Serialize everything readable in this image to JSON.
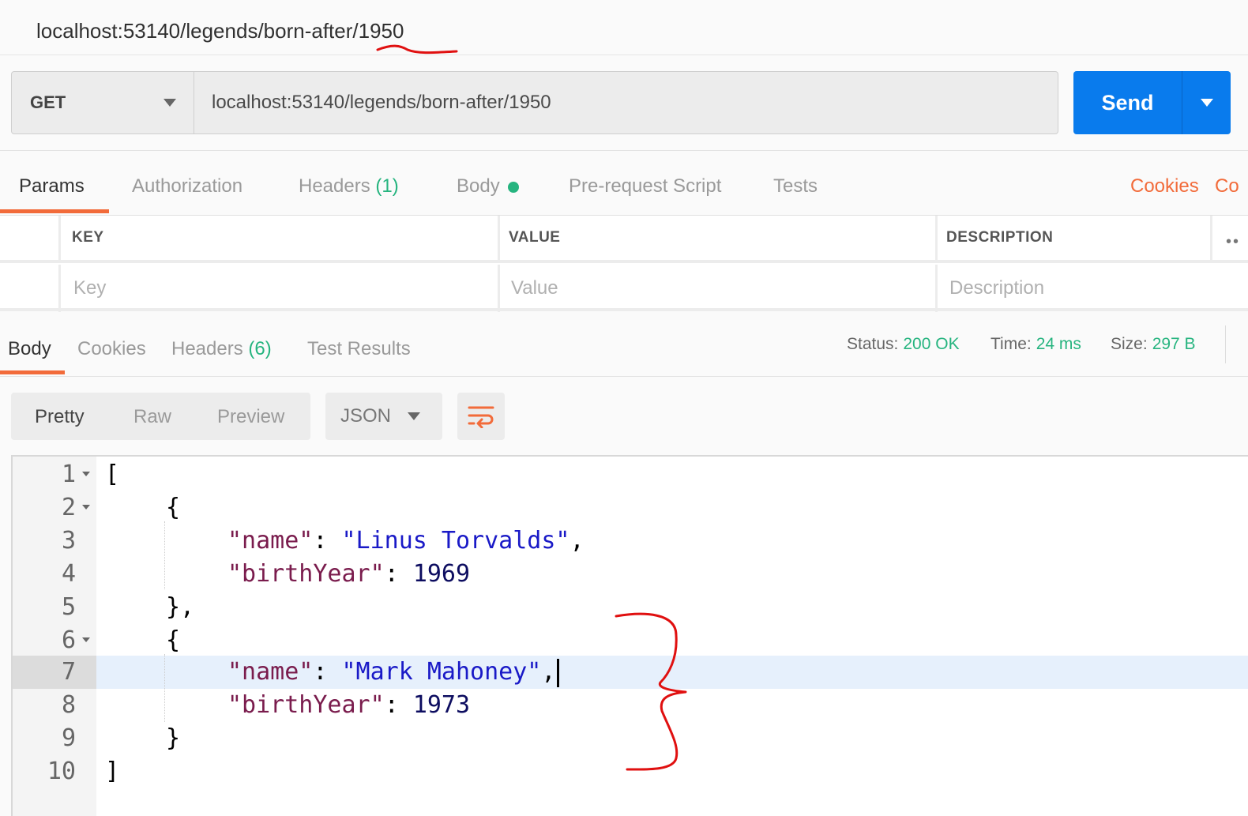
{
  "request": {
    "tab_title": "localhost:53140/legends/born-after/1950",
    "method": "GET",
    "url": "localhost:53140/legends/born-after/1950",
    "send_label": "Send"
  },
  "request_tabs": {
    "params": "Params",
    "authorization": "Authorization",
    "headers_label": "Headers",
    "headers_count": "(1)",
    "body": "Body",
    "prerequest": "Pre-request Script",
    "tests": "Tests",
    "cookies": "Cookies",
    "code_partial": "Co"
  },
  "params_table": {
    "col_key": "KEY",
    "col_value": "VALUE",
    "col_description": "DESCRIPTION",
    "key_placeholder": "Key",
    "value_placeholder": "Value",
    "description_placeholder": "Description"
  },
  "response_tabs": {
    "body": "Body",
    "cookies": "Cookies",
    "headers_label": "Headers",
    "headers_count": "(6)",
    "test_results": "Test Results"
  },
  "response_stats": {
    "status_label": "Status:",
    "status_value": "200 OK",
    "time_label": "Time:",
    "time_value": "24 ms",
    "size_label": "Size:",
    "size_value": "297 B"
  },
  "view_controls": {
    "pretty": "Pretty",
    "raw": "Raw",
    "preview": "Preview",
    "format": "JSON"
  },
  "response_body": {
    "line_numbers": [
      "1",
      "2",
      "3",
      "4",
      "5",
      "6",
      "7",
      "8",
      "9",
      "10"
    ],
    "open_bracket": "[",
    "close_bracket": "]",
    "open_brace": "{",
    "close_brace_comma": "},",
    "close_brace": "}",
    "key_name": "\"name\"",
    "key_birth": "\"birthYear\"",
    "colon": ": ",
    "comma": ",",
    "item1_name": "\"Linus Torvalds\"",
    "item1_birth": "1969",
    "item2_name": "\"Mark Mahoney\"",
    "item2_birth": "1973"
  },
  "colors": {
    "accent_orange": "#f26b3a",
    "send_blue": "#097bed",
    "success_green": "#26b47f",
    "annotation_red": "#e01010"
  }
}
